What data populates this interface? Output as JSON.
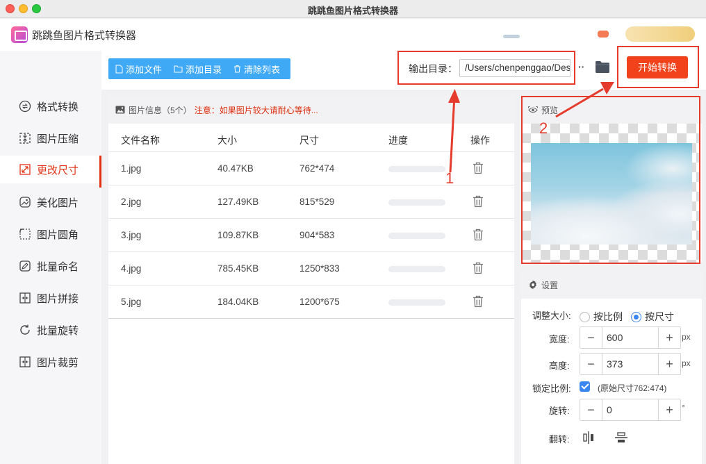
{
  "window": {
    "title": "跳跳鱼图片格式转换器"
  },
  "app": {
    "name": "跳跳鱼图片格式转换器"
  },
  "sidebar": {
    "items": [
      {
        "label": "格式转换",
        "icon": "format-convert-icon",
        "active": false
      },
      {
        "label": "图片压缩",
        "icon": "compress-icon",
        "active": false
      },
      {
        "label": "更改尺寸",
        "icon": "resize-icon",
        "active": true
      },
      {
        "label": "美化图片",
        "icon": "beautify-icon",
        "active": false
      },
      {
        "label": "图片圆角",
        "icon": "rounded-corner-icon",
        "active": false
      },
      {
        "label": "批量命名",
        "icon": "rename-icon",
        "active": false
      },
      {
        "label": "图片拼接",
        "icon": "stitch-icon",
        "active": false
      },
      {
        "label": "批量旋转",
        "icon": "rotate-icon",
        "active": false
      },
      {
        "label": "图片裁剪",
        "icon": "crop-icon",
        "active": false
      }
    ]
  },
  "toolbar": {
    "add_file": "添加文件",
    "add_dir": "添加目录",
    "clear_list": "清除列表",
    "output_label": "输出目录：",
    "output_path": "/Users/chenpenggao/Desktop",
    "more": "··",
    "start": "开始转换"
  },
  "table": {
    "info_title": "图片信息（5个）",
    "warning": "注意：如果图片较大请耐心等待...",
    "headers": [
      "文件名称",
      "大小",
      "尺寸",
      "进度",
      "操作"
    ],
    "rows": [
      {
        "name": "1.jpg",
        "size": "40.47KB",
        "dims": "762*474",
        "progress": 0
      },
      {
        "name": "2.jpg",
        "size": "127.49KB",
        "dims": "815*529",
        "progress": 0
      },
      {
        "name": "3.jpg",
        "size": "109.87KB",
        "dims": "904*583",
        "progress": 0
      },
      {
        "name": "4.jpg",
        "size": "785.45KB",
        "dims": "1250*833",
        "progress": 0
      },
      {
        "name": "5.jpg",
        "size": "184.04KB",
        "dims": "1200*675",
        "progress": 0
      }
    ]
  },
  "preview": {
    "title": "预览"
  },
  "settings": {
    "title": "设置",
    "resize_label": "调整大小:",
    "by_ratio": "按比例",
    "by_size": "按尺寸",
    "selected_mode": "按尺寸",
    "width_label": "宽度:",
    "width_value": "600",
    "height_label": "高度:",
    "height_value": "373",
    "unit_px": "px",
    "lock_label": "锁定比例:",
    "lock_checked": true,
    "original_note": "(原始尺寸762:474)",
    "rotate_label": "旋转:",
    "rotate_value": "0",
    "rotate_unit": "°",
    "flip_label": "翻转:"
  },
  "annotations": {
    "marker_1": "1",
    "marker_2": "2"
  },
  "colors": {
    "accent_red": "#f1421b",
    "toolbar_blue": "#3fa9f5",
    "annotation_red": "#e53b2c"
  }
}
